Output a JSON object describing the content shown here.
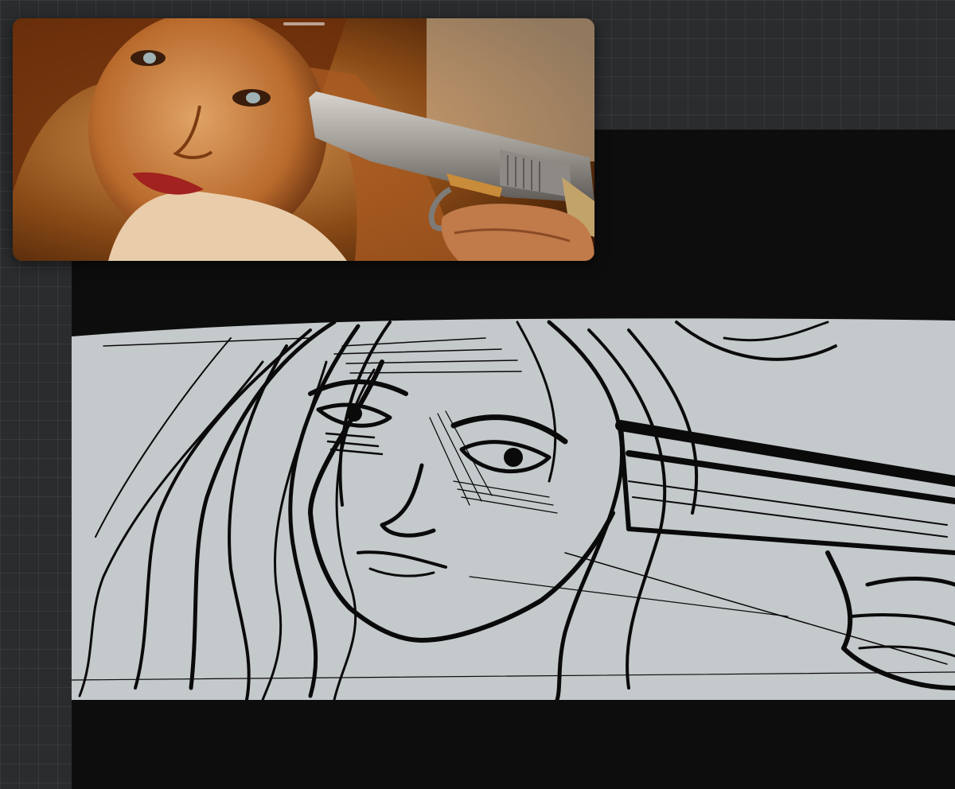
{
  "app": {
    "reference_window": {
      "image_name": "reference-image",
      "handle_icon": "drag-handle-icon"
    },
    "canvas": {
      "sketch_name": "storyboard-sketch"
    },
    "colors": {
      "workspace_bg": "#2b2c2e",
      "canvas_bg": "#0e0d0e",
      "paper": "#c4c9cb",
      "ink": "#0b0a0a"
    }
  }
}
